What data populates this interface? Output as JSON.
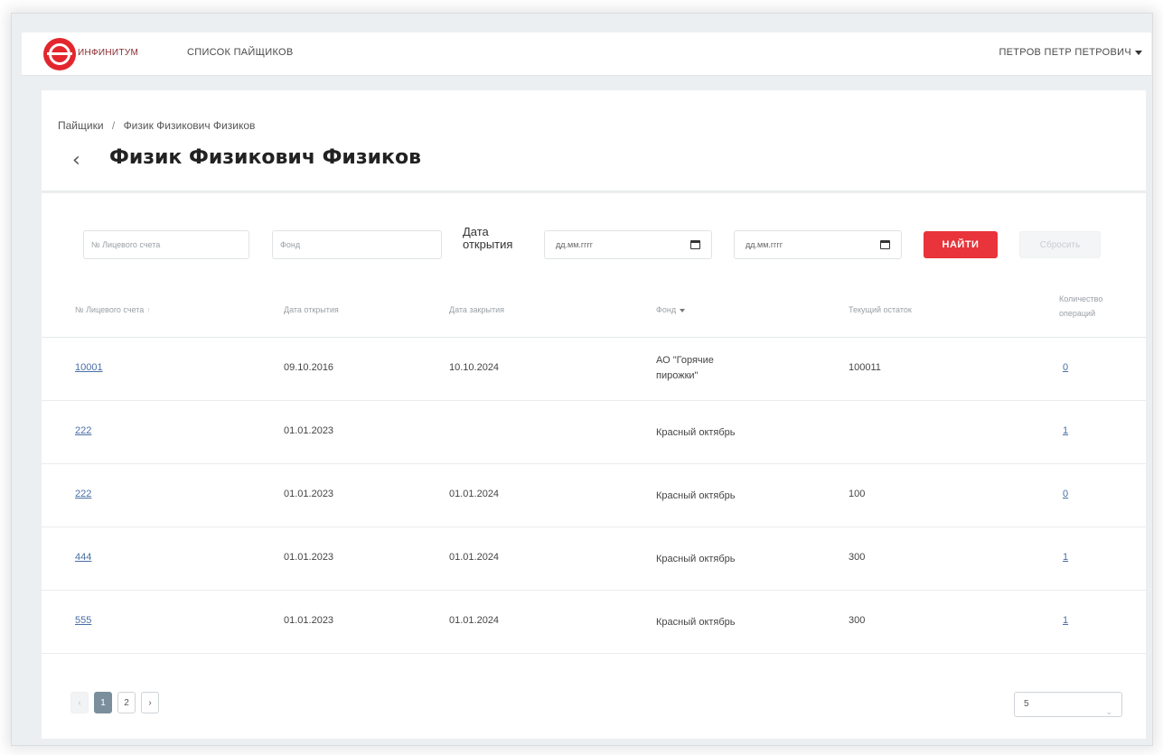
{
  "topbar": {
    "brand": "ИНФИНИТУМ",
    "nav_link": "СПИСОК ПАЙЩИКОВ",
    "user_name": "ПЕТРОВ ПЕТР ПЕТРОВИЧ"
  },
  "breadcrumb": {
    "parent": "Пайщики",
    "separator": "/",
    "current": "Физик Физикович Физиков"
  },
  "page": {
    "back_glyph": "‹",
    "title": "Физик Физикович Физиков"
  },
  "filters": {
    "account_placeholder": "№ Лицевого счета",
    "fund_placeholder": "Фонд",
    "date_label": "Дата открытия",
    "date_from_placeholder": "дд.мм.гггг",
    "date_to_placeholder": "дд.мм.гггг",
    "find_label": "НАЙТИ",
    "reset_label": "Сбросить"
  },
  "table": {
    "columns": {
      "account": "№ Лицевого счета",
      "open_date": "Дата открытия",
      "close_date": "Дата закрытия",
      "fund": "Фонд",
      "balance": "Текущий остаток",
      "operations": "Количество операций"
    },
    "sort_glyph": "↑",
    "rows": [
      {
        "account": "10001",
        "open_date": "09.10.2016",
        "close_date": "10.10.2024",
        "fund": "АО \"Горячие пирожки\"",
        "balance": "100011",
        "operations": "0"
      },
      {
        "account": "222",
        "open_date": "01.01.2023",
        "close_date": "",
        "fund": "Красный октябрь",
        "balance": "",
        "operations": "1"
      },
      {
        "account": "222",
        "open_date": "01.01.2023",
        "close_date": "01.01.2024",
        "fund": "Красный октябрь",
        "balance": "100",
        "operations": "0"
      },
      {
        "account": "444",
        "open_date": "01.01.2023",
        "close_date": "01.01.2024",
        "fund": "Красный октябрь",
        "balance": "300",
        "operations": "1"
      },
      {
        "account": "555",
        "open_date": "01.01.2023",
        "close_date": "01.01.2024",
        "fund": "Красный октябрь",
        "balance": "300",
        "operations": "1"
      }
    ]
  },
  "pagination": {
    "prev": "‹",
    "pages": [
      "1",
      "2"
    ],
    "next": "›",
    "current_page": "1",
    "page_size": "5",
    "page_size_chevron": "⌄"
  },
  "colors": {
    "accent_red": "#e8343a",
    "link_blue": "#4a6fa5",
    "active_page": "#7b8e9b"
  }
}
